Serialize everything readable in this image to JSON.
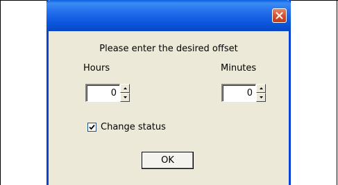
{
  "dialog": {
    "prompt": "Please enter the desired offset",
    "hours": {
      "label": "Hours",
      "value": "0"
    },
    "minutes": {
      "label": "Minutes",
      "value": "0"
    },
    "change_status": {
      "label": "Change status",
      "checked": true
    },
    "ok_label": "OK",
    "close_icon": "close-icon"
  },
  "colors": {
    "titlebar": "#0c58df",
    "dialog_bg": "#ece9d8",
    "close_button": "#d14a2a"
  }
}
